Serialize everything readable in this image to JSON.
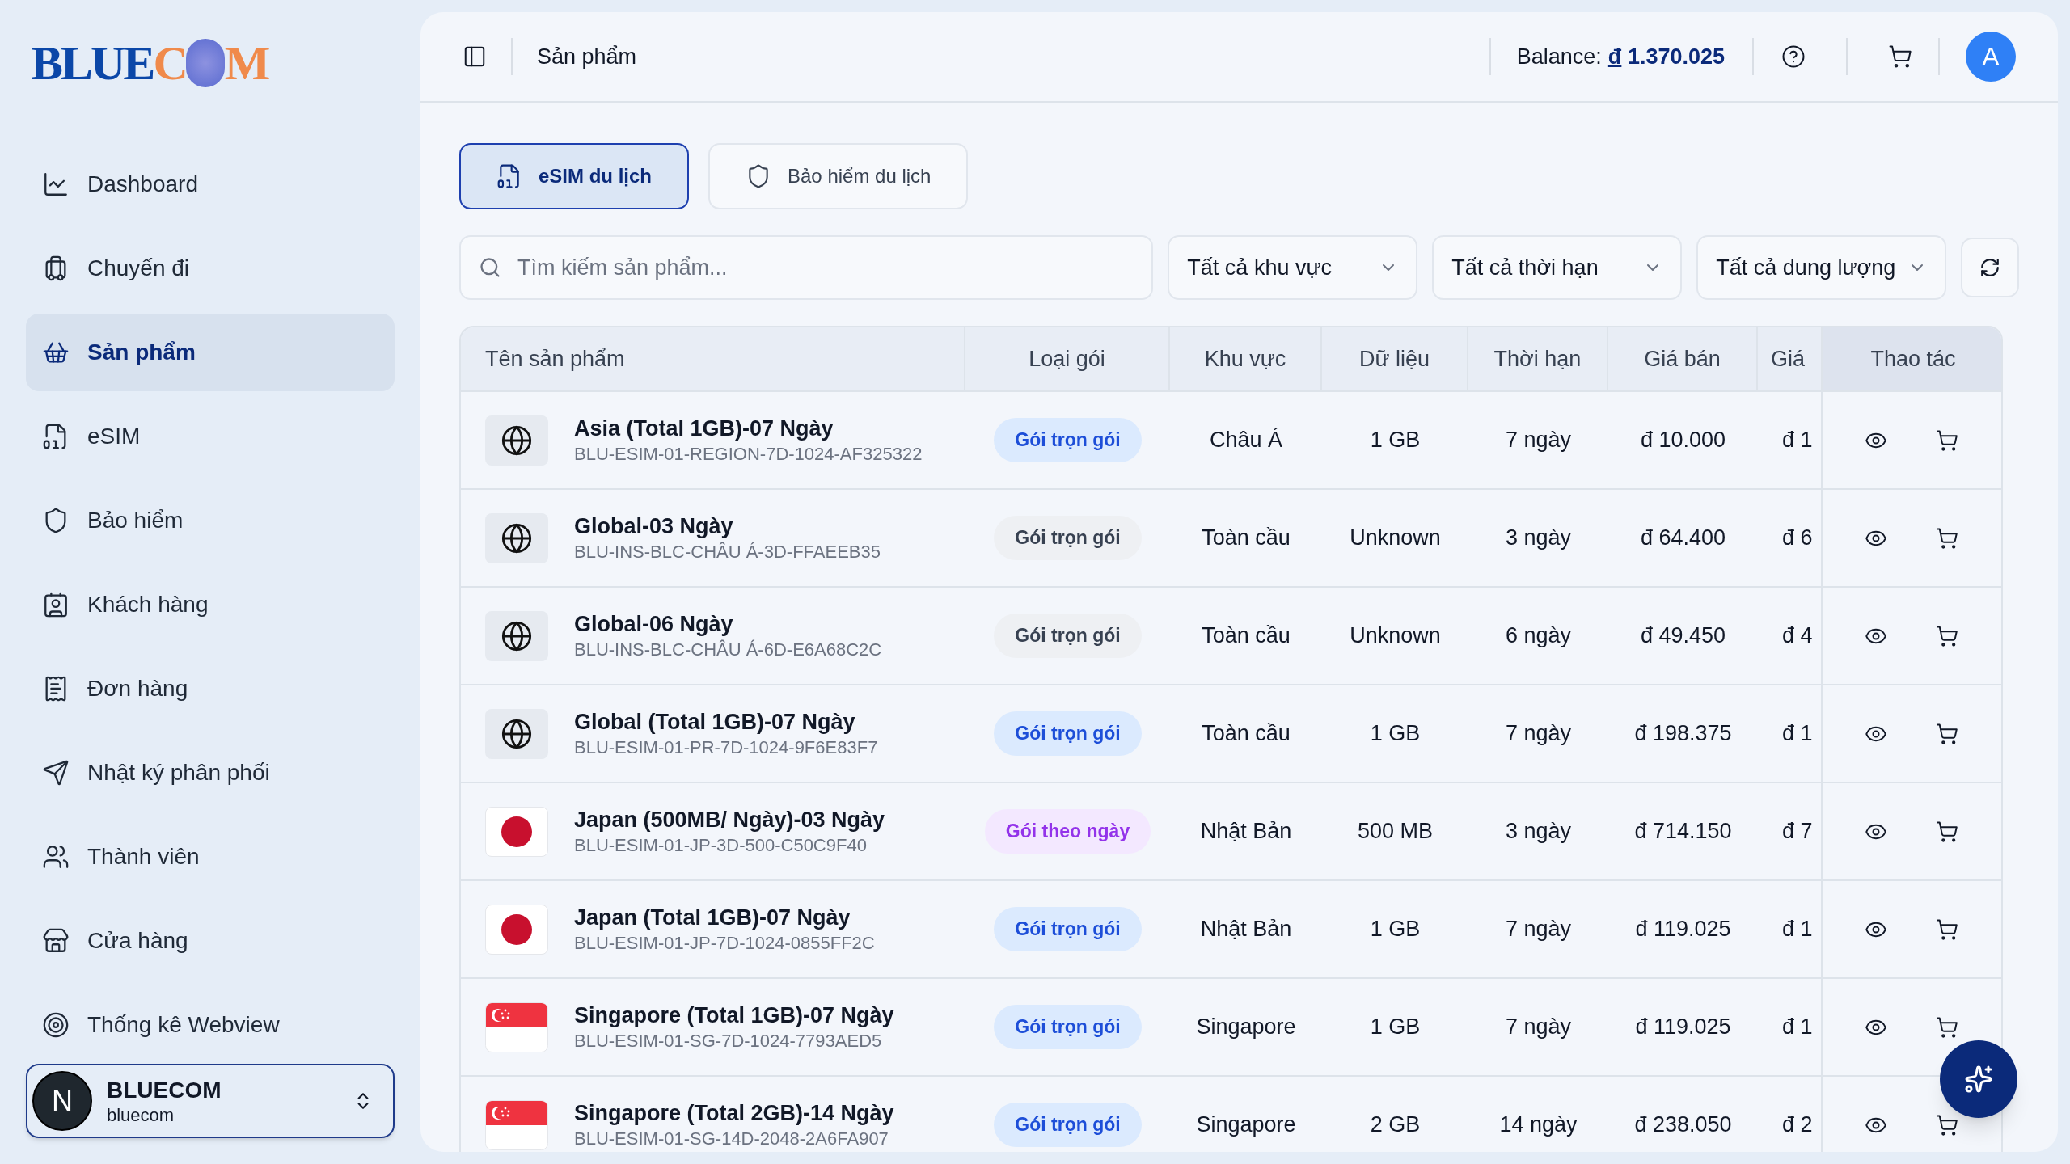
{
  "logo": {
    "blue_part": "BLUE",
    "orange_part": "COM"
  },
  "sidebar": {
    "items": [
      {
        "label": "Dashboard",
        "selected": false
      },
      {
        "label": "Chuyến đi",
        "selected": false
      },
      {
        "label": "Sản phẩm",
        "selected": true
      },
      {
        "label": "eSIM",
        "selected": false
      },
      {
        "label": "Bảo hiểm",
        "selected": false
      },
      {
        "label": "Khách hàng",
        "selected": false
      },
      {
        "label": "Đơn hàng",
        "selected": false
      },
      {
        "label": "Nhật ký phân phối",
        "selected": false
      },
      {
        "label": "Thành viên",
        "selected": false
      },
      {
        "label": "Cửa hàng",
        "selected": false
      },
      {
        "label": "Thống kê Webview",
        "selected": false
      }
    ],
    "account": {
      "initial": "N",
      "name": "BLUECOM",
      "handle": "bluecom"
    }
  },
  "header": {
    "title": "Sản phẩm",
    "balance_label": "Balance:",
    "currency": "đ",
    "balance": "1.370.025",
    "avatar": "A"
  },
  "tabs": [
    {
      "label": "eSIM du lịch",
      "selected": true
    },
    {
      "label": "Bảo hiểm du lịch",
      "selected": false
    }
  ],
  "search": {
    "placeholder": "Tìm kiếm sản phẩm..."
  },
  "filters": [
    "Tất cả khu vực",
    "Tất cả thời hạn",
    "Tất cả dung lượng"
  ],
  "table": {
    "columns": [
      "Tên sản phẩm",
      "Loại gói",
      "Khu vực",
      "Dữ liệu",
      "Thời hạn",
      "Giá bán",
      "Giá",
      "Thao tác"
    ],
    "rows": [
      {
        "kind": "globe",
        "name": "Asia (Total 1GB)-07 Ngày",
        "code": "BLU-ESIM-01-REGION-7D-1024-AF325322",
        "plan": {
          "label": "Gói trọn gói",
          "kind": "primary"
        },
        "region": "Châu Á",
        "data": "1 GB",
        "duration": "7 ngày",
        "price": "đ 10.000",
        "column_7": "đ 1"
      },
      {
        "kind": "globe",
        "name": "Global-03 Ngày",
        "code": "BLU-INS-BLC-CHÂU Á-3D-FFAEEB35",
        "plan": {
          "label": "Gói trọn gói",
          "kind": "muted"
        },
        "region": "Toàn cầu",
        "data": "Unknown",
        "duration": "3 ngày",
        "price": "đ 64.400",
        "column_7": "đ 6"
      },
      {
        "kind": "globe",
        "name": "Global-06 Ngày",
        "code": "BLU-INS-BLC-CHÂU Á-6D-E6A68C2C",
        "plan": {
          "label": "Gói trọn gói",
          "kind": "muted"
        },
        "region": "Toàn cầu",
        "data": "Unknown",
        "duration": "6 ngày",
        "price": "đ 49.450",
        "column_7": "đ 4"
      },
      {
        "kind": "globe",
        "name": "Global (Total 1GB)-07 Ngày",
        "code": "BLU-ESIM-01-PR-7D-1024-9F6E83F7",
        "plan": {
          "label": "Gói trọn gói",
          "kind": "primary"
        },
        "region": "Toàn cầu",
        "data": "1 GB",
        "duration": "7 ngày",
        "price": "đ 198.375",
        "column_7": "đ 1"
      },
      {
        "kind": "japan",
        "name": "Japan (500MB/ Ngày)-03 Ngày",
        "code": "BLU-ESIM-01-JP-3D-500-C50C9F40",
        "plan": {
          "label": "Gói theo ngày",
          "kind": "daily"
        },
        "region": "Nhật Bản",
        "data": "500 MB",
        "duration": "3 ngày",
        "price": "đ 714.150",
        "column_7": "đ 7"
      },
      {
        "kind": "japan",
        "name": "Japan (Total 1GB)-07 Ngày",
        "code": "BLU-ESIM-01-JP-7D-1024-0855FF2C",
        "plan": {
          "label": "Gói trọn gói",
          "kind": "primary"
        },
        "region": "Nhật Bản",
        "data": "1 GB",
        "duration": "7 ngày",
        "price": "đ 119.025",
        "column_7": "đ 1"
      },
      {
        "kind": "singapore",
        "name": "Singapore (Total 1GB)-07 Ngày",
        "code": "BLU-ESIM-01-SG-7D-1024-7793AED5",
        "plan": {
          "label": "Gói trọn gói",
          "kind": "primary"
        },
        "region": "Singapore",
        "data": "1 GB",
        "duration": "7 ngày",
        "price": "đ 119.025",
        "column_7": "đ 1"
      },
      {
        "kind": "singapore",
        "name": "Singapore (Total 2GB)-14 Ngày",
        "code": "BLU-ESIM-01-SG-14D-2048-2A6FA907",
        "plan": {
          "label": "Gói trọn gói",
          "kind": "primary"
        },
        "region": "Singapore",
        "data": "2 GB",
        "duration": "14 ngày",
        "price": "đ 238.050",
        "column_7": "đ 2"
      }
    ]
  }
}
